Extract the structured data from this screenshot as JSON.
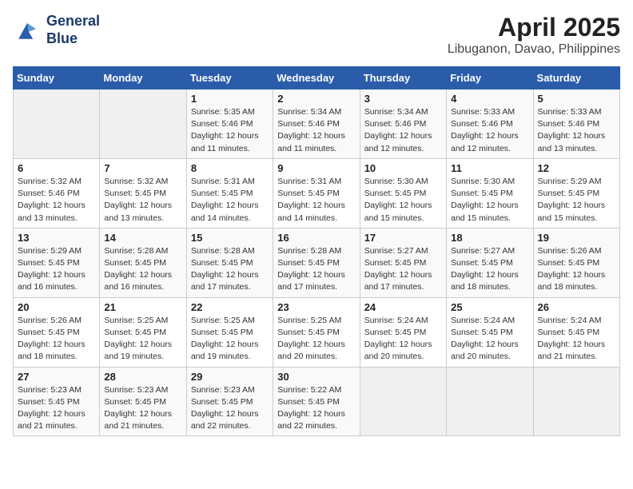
{
  "header": {
    "logo_line1": "General",
    "logo_line2": "Blue",
    "title": "April 2025",
    "subtitle": "Libuganon, Davao, Philippines"
  },
  "weekdays": [
    "Sunday",
    "Monday",
    "Tuesday",
    "Wednesday",
    "Thursday",
    "Friday",
    "Saturday"
  ],
  "weeks": [
    [
      {
        "day": "",
        "info": ""
      },
      {
        "day": "",
        "info": ""
      },
      {
        "day": "1",
        "info": "Sunrise: 5:35 AM\nSunset: 5:46 PM\nDaylight: 12 hours and 11 minutes."
      },
      {
        "day": "2",
        "info": "Sunrise: 5:34 AM\nSunset: 5:46 PM\nDaylight: 12 hours and 11 minutes."
      },
      {
        "day": "3",
        "info": "Sunrise: 5:34 AM\nSunset: 5:46 PM\nDaylight: 12 hours and 12 minutes."
      },
      {
        "day": "4",
        "info": "Sunrise: 5:33 AM\nSunset: 5:46 PM\nDaylight: 12 hours and 12 minutes."
      },
      {
        "day": "5",
        "info": "Sunrise: 5:33 AM\nSunset: 5:46 PM\nDaylight: 12 hours and 13 minutes."
      }
    ],
    [
      {
        "day": "6",
        "info": "Sunrise: 5:32 AM\nSunset: 5:46 PM\nDaylight: 12 hours and 13 minutes."
      },
      {
        "day": "7",
        "info": "Sunrise: 5:32 AM\nSunset: 5:45 PM\nDaylight: 12 hours and 13 minutes."
      },
      {
        "day": "8",
        "info": "Sunrise: 5:31 AM\nSunset: 5:45 PM\nDaylight: 12 hours and 14 minutes."
      },
      {
        "day": "9",
        "info": "Sunrise: 5:31 AM\nSunset: 5:45 PM\nDaylight: 12 hours and 14 minutes."
      },
      {
        "day": "10",
        "info": "Sunrise: 5:30 AM\nSunset: 5:45 PM\nDaylight: 12 hours and 15 minutes."
      },
      {
        "day": "11",
        "info": "Sunrise: 5:30 AM\nSunset: 5:45 PM\nDaylight: 12 hours and 15 minutes."
      },
      {
        "day": "12",
        "info": "Sunrise: 5:29 AM\nSunset: 5:45 PM\nDaylight: 12 hours and 15 minutes."
      }
    ],
    [
      {
        "day": "13",
        "info": "Sunrise: 5:29 AM\nSunset: 5:45 PM\nDaylight: 12 hours and 16 minutes."
      },
      {
        "day": "14",
        "info": "Sunrise: 5:28 AM\nSunset: 5:45 PM\nDaylight: 12 hours and 16 minutes."
      },
      {
        "day": "15",
        "info": "Sunrise: 5:28 AM\nSunset: 5:45 PM\nDaylight: 12 hours and 17 minutes."
      },
      {
        "day": "16",
        "info": "Sunrise: 5:28 AM\nSunset: 5:45 PM\nDaylight: 12 hours and 17 minutes."
      },
      {
        "day": "17",
        "info": "Sunrise: 5:27 AM\nSunset: 5:45 PM\nDaylight: 12 hours and 17 minutes."
      },
      {
        "day": "18",
        "info": "Sunrise: 5:27 AM\nSunset: 5:45 PM\nDaylight: 12 hours and 18 minutes."
      },
      {
        "day": "19",
        "info": "Sunrise: 5:26 AM\nSunset: 5:45 PM\nDaylight: 12 hours and 18 minutes."
      }
    ],
    [
      {
        "day": "20",
        "info": "Sunrise: 5:26 AM\nSunset: 5:45 PM\nDaylight: 12 hours and 18 minutes."
      },
      {
        "day": "21",
        "info": "Sunrise: 5:25 AM\nSunset: 5:45 PM\nDaylight: 12 hours and 19 minutes."
      },
      {
        "day": "22",
        "info": "Sunrise: 5:25 AM\nSunset: 5:45 PM\nDaylight: 12 hours and 19 minutes."
      },
      {
        "day": "23",
        "info": "Sunrise: 5:25 AM\nSunset: 5:45 PM\nDaylight: 12 hours and 20 minutes."
      },
      {
        "day": "24",
        "info": "Sunrise: 5:24 AM\nSunset: 5:45 PM\nDaylight: 12 hours and 20 minutes."
      },
      {
        "day": "25",
        "info": "Sunrise: 5:24 AM\nSunset: 5:45 PM\nDaylight: 12 hours and 20 minutes."
      },
      {
        "day": "26",
        "info": "Sunrise: 5:24 AM\nSunset: 5:45 PM\nDaylight: 12 hours and 21 minutes."
      }
    ],
    [
      {
        "day": "27",
        "info": "Sunrise: 5:23 AM\nSunset: 5:45 PM\nDaylight: 12 hours and 21 minutes."
      },
      {
        "day": "28",
        "info": "Sunrise: 5:23 AM\nSunset: 5:45 PM\nDaylight: 12 hours and 21 minutes."
      },
      {
        "day": "29",
        "info": "Sunrise: 5:23 AM\nSunset: 5:45 PM\nDaylight: 12 hours and 22 minutes."
      },
      {
        "day": "30",
        "info": "Sunrise: 5:22 AM\nSunset: 5:45 PM\nDaylight: 12 hours and 22 minutes."
      },
      {
        "day": "",
        "info": ""
      },
      {
        "day": "",
        "info": ""
      },
      {
        "day": "",
        "info": ""
      }
    ]
  ]
}
